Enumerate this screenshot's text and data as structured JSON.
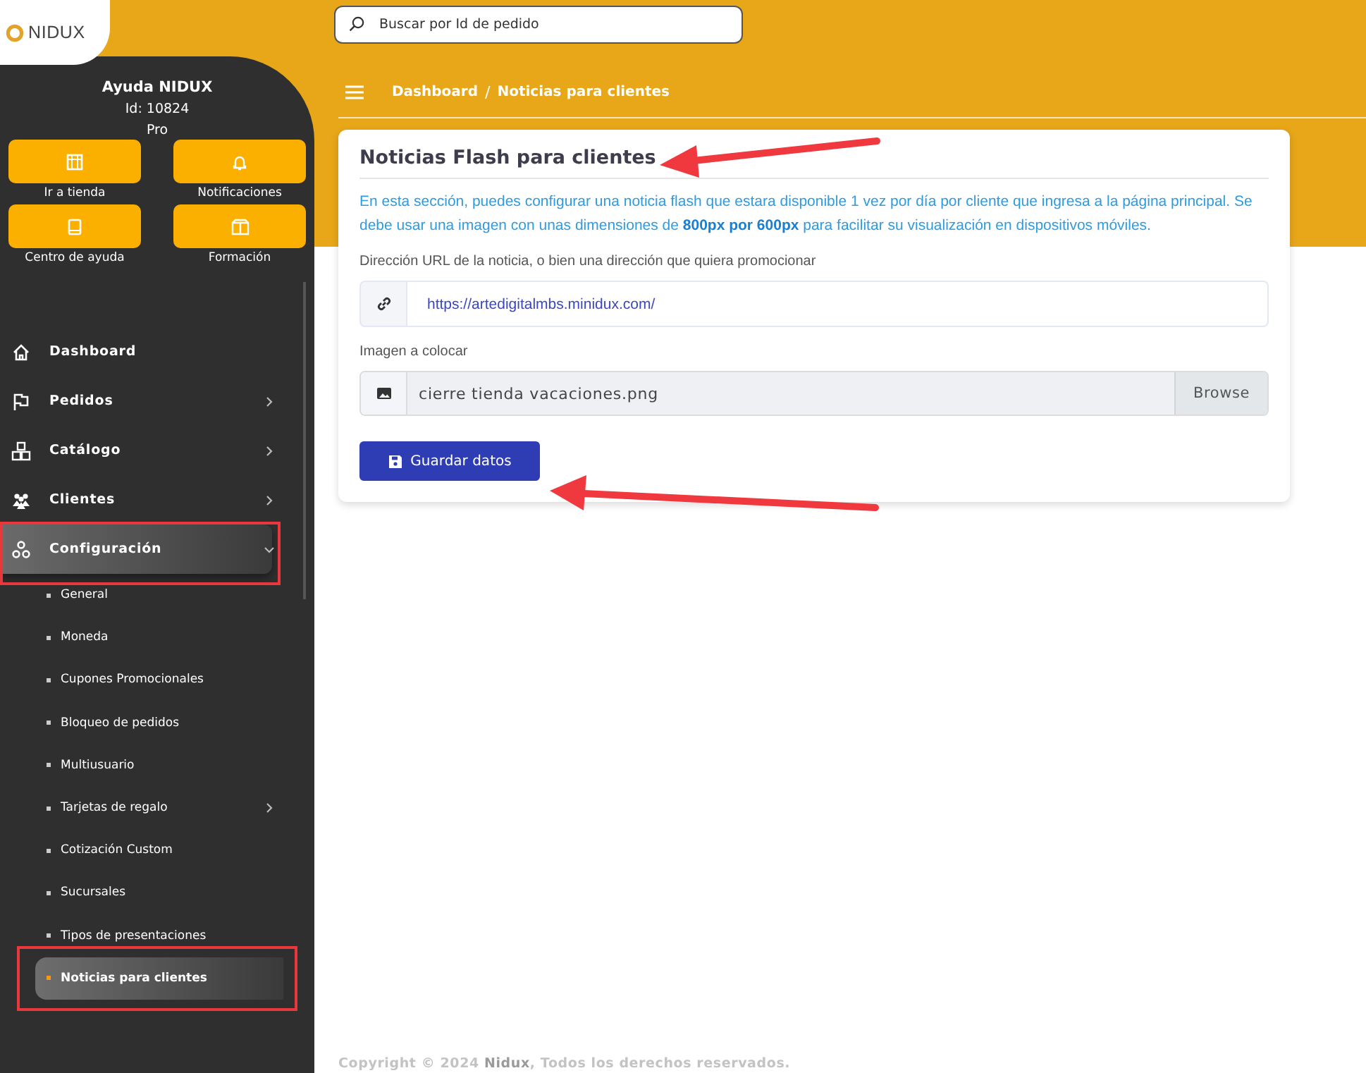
{
  "logo": {
    "text": "NIDUX"
  },
  "search": {
    "placeholder": "Buscar por Id de pedido"
  },
  "profile": {
    "name": "Ayuda NIDUX",
    "id": "Id: 10824",
    "plan": "Pro"
  },
  "quick_actions": [
    {
      "kind": "store",
      "label": "Ir a tienda"
    },
    {
      "kind": "bell",
      "label": "Notificaciones"
    },
    {
      "kind": "book",
      "label": "Centro de ayuda"
    },
    {
      "kind": "training",
      "label": "Formación"
    }
  ],
  "menu": [
    {
      "kind": "home",
      "label": "Dashboard",
      "has_submenu": false,
      "selected": false,
      "highlighted": false
    },
    {
      "kind": "flag",
      "label": "Pedidos",
      "has_submenu": true,
      "selected": false,
      "highlighted": false
    },
    {
      "kind": "boxes",
      "label": "Catálogo",
      "has_submenu": true,
      "selected": false,
      "highlighted": false
    },
    {
      "kind": "people",
      "label": "Clientes",
      "has_submenu": true,
      "selected": false,
      "highlighted": false
    },
    {
      "kind": "nodes",
      "label": "Configuración",
      "has_submenu": true,
      "selected": true,
      "highlighted": true,
      "expanded": true,
      "children": [
        {
          "label": "General",
          "has_submenu": false,
          "selected": false,
          "highlighted": false
        },
        {
          "label": "Moneda",
          "has_submenu": false,
          "selected": false,
          "highlighted": false
        },
        {
          "label": "Cupones Promocionales",
          "has_submenu": false,
          "selected": false,
          "highlighted": false
        },
        {
          "label": "Bloqueo de pedidos",
          "has_submenu": false,
          "selected": false,
          "highlighted": false
        },
        {
          "label": "Multiusuario",
          "has_submenu": false,
          "selected": false,
          "highlighted": false
        },
        {
          "label": "Tarjetas de regalo",
          "has_submenu": true,
          "selected": false,
          "highlighted": false
        },
        {
          "label": "Cotización Custom",
          "has_submenu": false,
          "selected": false,
          "highlighted": false
        },
        {
          "label": "Sucursales",
          "has_submenu": false,
          "selected": false,
          "highlighted": false
        },
        {
          "label": "Tipos de presentaciones",
          "has_submenu": false,
          "selected": false,
          "highlighted": false
        },
        {
          "label": "Noticias para clientes",
          "has_submenu": false,
          "selected": true,
          "highlighted": true
        }
      ]
    }
  ],
  "breadcrumb": [
    "Dashboard",
    "Noticias para clientes"
  ],
  "breadcrumb_separator": "/",
  "card": {
    "title": "Noticias Flash para clientes",
    "description": "En esta sección, puedes configurar una noticia flash que estara disponible 1 vez por día por cliente que ingresa a la página principal. Se debe usar una imagen con unas dimensiones de **800px por 600px** para facilitar su visualización en dispositivos móviles.",
    "url_label": "Dirección URL de la noticia, o bien una dirección que quiera promocionar",
    "url_value": "https://artedigitalmbs.minidux.com/",
    "image_label": "Imagen a colocar",
    "image_value": "cierre tienda vacaciones.png",
    "browse_button": "Browse",
    "save_button": "Guardar datos"
  },
  "footer": "Copyright © 2024 **Nidux**, Todos los derechos reservados."
}
